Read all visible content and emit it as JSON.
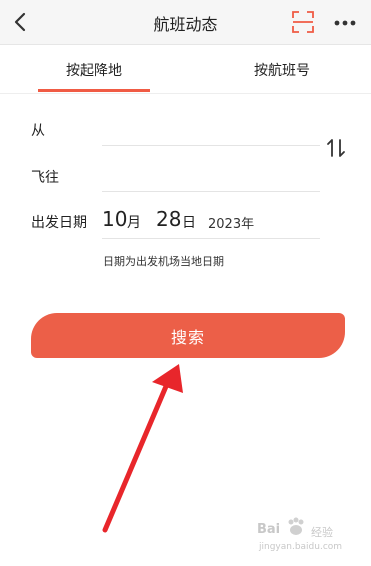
{
  "header": {
    "title": "航班动态"
  },
  "tabs": [
    {
      "label": "按起降地"
    },
    {
      "label": "按航班号"
    }
  ],
  "form": {
    "from_label": "从",
    "to_label": "飞往",
    "date_label": "出发日期",
    "month_value": "10",
    "month_unit": "月",
    "day_value": "28",
    "day_unit": "日",
    "year_text": "2023年",
    "hint": "日期为出发机场当地日期"
  },
  "search_button_label": "搜索",
  "watermark": {
    "brand": "Bai",
    "brand2": "经验",
    "site": "jingyan.baidu.com"
  },
  "colors": {
    "accent": "#f05b44",
    "button": "#ec5f48",
    "arrow": "#e8262b"
  },
  "icons": {
    "back": "chevron-left-icon",
    "scan": "scan-icon",
    "more": "more-icon",
    "swap": "swap-icon",
    "arrow": "red-arrow-annotation",
    "watermark": "baidu-paw-icon"
  }
}
